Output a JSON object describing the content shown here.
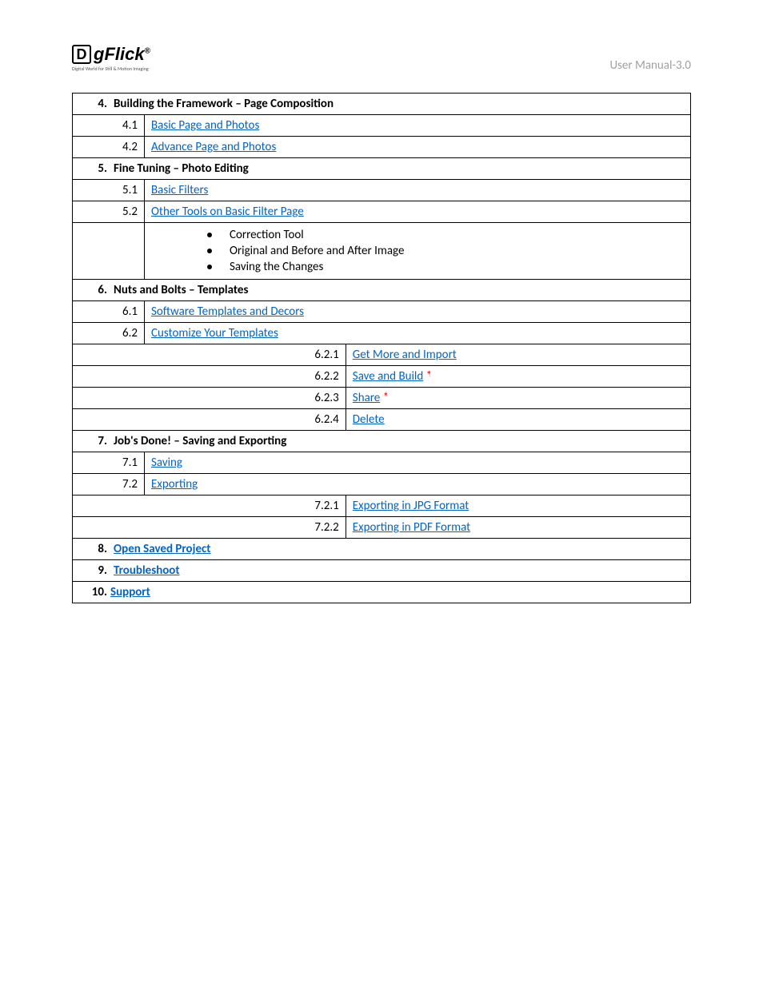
{
  "header": {
    "logo_d": "D",
    "logo_text": "gFlick",
    "logo_reg": "®",
    "logo_subtitle": "Digital World for Still & Motion Imaging",
    "right_text": "User Manual-3.0"
  },
  "toc": {
    "s4": {
      "num": "4.",
      "title": "Building the Framework – Page Composition"
    },
    "s4_1": {
      "num": "4.1",
      "text": "Basic Page and Photos"
    },
    "s4_2": {
      "num": "4.2",
      "text": "Advance Page and Photos"
    },
    "s5": {
      "num": "5.",
      "title": "Fine Tuning – Photo Editing"
    },
    "s5_1": {
      "num": "5.1",
      "text": "Basic Filters"
    },
    "s5_2": {
      "num": "5.2",
      "text": "Other Tools on Basic Filter Page"
    },
    "s5_2_b1": "Correction Tool",
    "s5_2_b2": "Original and Before and After Image",
    "s5_2_b3": "Saving the Changes",
    "s6": {
      "num": "6.",
      "title": "Nuts and Bolts – Templates"
    },
    "s6_1": {
      "num": "6.1",
      "text": "Software Templates and Decors"
    },
    "s6_2": {
      "num": "6.2",
      "text": "Customize Your Templates"
    },
    "s6_2_1": {
      "num": "6.2.1",
      "text": "Get More and Import"
    },
    "s6_2_2": {
      "num": "6.2.2",
      "text": "Save and Build",
      "star": " *"
    },
    "s6_2_3": {
      "num": "6.2.3",
      "text": "Share",
      "star": " *"
    },
    "s6_2_4": {
      "num": "6.2.4",
      "text": "Delete"
    },
    "s7": {
      "num": "7.",
      "title": "Job's Done! – Saving and Exporting"
    },
    "s7_1": {
      "num": "7.1",
      "text": "Saving"
    },
    "s7_2": {
      "num": "7.2",
      "text": "Exporting"
    },
    "s7_2_1": {
      "num": "7.2.1",
      "text": "Exporting in JPG Format"
    },
    "s7_2_2": {
      "num": "7.2.2",
      "text": "Exporting in PDF Format"
    },
    "s8": {
      "num": "8.",
      "text": "Open Saved Project"
    },
    "s9": {
      "num": "9.",
      "text": "Troubleshoot"
    },
    "s10": {
      "num": "10.",
      "text": "Support"
    }
  }
}
